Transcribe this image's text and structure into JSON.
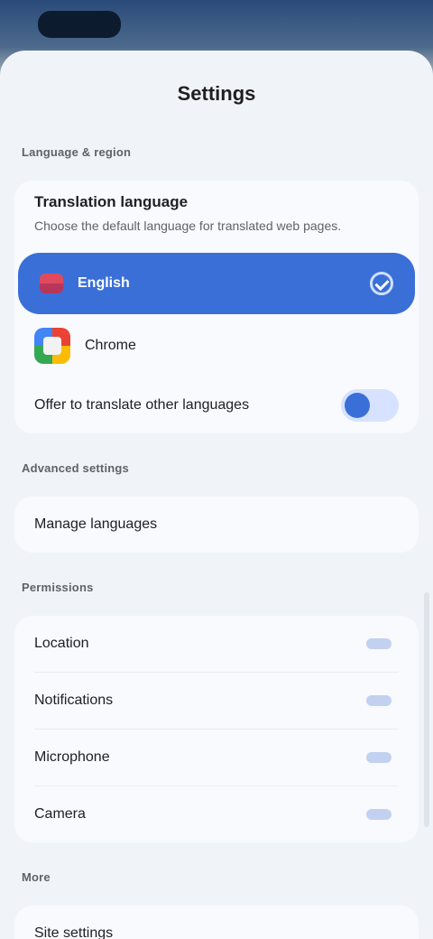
{
  "sheet": {
    "title": "Settings"
  },
  "sections": {
    "language_label": "Language & region",
    "language_card": {
      "title": "Translation language",
      "description": "Choose the default language for translated web pages."
    },
    "selected_language": "English",
    "app": {
      "name": "Chrome"
    },
    "toggle_label": "Offer to translate other languages",
    "toggle_on": true,
    "advanced_label": "Advanced settings",
    "advanced_row": "Manage languages",
    "permissions_label": "Permissions",
    "permission_items": [
      {
        "label": "Location"
      },
      {
        "label": "Notifications"
      },
      {
        "label": "Microphone"
      },
      {
        "label": "Camera"
      }
    ],
    "more_label": "More",
    "more_row": "Site settings"
  },
  "colors": {
    "accent": "#3a6fd8",
    "sheet_bg": "#f0f4f9",
    "card_bg": "#f8fafd"
  },
  "icons": {
    "flag": "flag-icon",
    "check": "check-circle-icon",
    "app": "chrome-icon"
  }
}
